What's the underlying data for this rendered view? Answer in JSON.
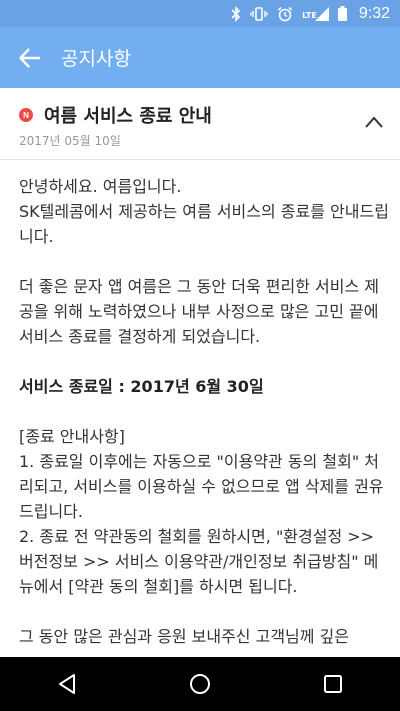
{
  "status_bar": {
    "time": "9:32",
    "network": "LTE",
    "icons": [
      "bluetooth-icon",
      "vibrate-icon",
      "alarm-icon",
      "signal-icon",
      "battery-icon"
    ]
  },
  "app_bar": {
    "title": "공지사항",
    "back_icon": "back-arrow-icon"
  },
  "notice": {
    "badge": "N",
    "title": "여름 서비스 종료 안내",
    "date": "2017년 05월 10일",
    "expanded": true
  },
  "content": {
    "paragraphs": [
      "안녕하세요. 여름입니다.\nSK텔레콤에서 제공하는 여름 서비스의 종료를 안내드립니다.",
      "더 좋은 문자 앱 여름은 그 동안 더욱 편리한 서비스 제공을 위해 노력하였으나 내부 사정으로 많은 고민 끝에 서비스 종료를 결정하게 되었습니다.",
      "서비스 종료일 : 2017년 6월 30일",
      "[종료 안내사항]\n1. 종료일 이후에는 자동으로 \"이용약관 동의 철회\" 처리되고, 서비스를 이용하실 수 없으므로 앱 삭제를 권유 드립니다.\n2. 종료 전 약관동의 철회를 원하시면, \"환경설정 >> 버전정보 >> 서비스 이용약관/개인정보 취급방침\" 메뉴에서 [약관 동의 철회]를 하시면 됩니다.",
      "그 동안 많은 관심과 응원 보내주신 고객님께 깊은"
    ]
  },
  "nav_bar": {
    "icons": [
      "nav-back-icon",
      "nav-home-icon",
      "nav-recents-icon"
    ]
  },
  "colors": {
    "status_bar": "#6aa2e6",
    "app_bar": "#72aef0",
    "badge": "#ef4a4a"
  }
}
